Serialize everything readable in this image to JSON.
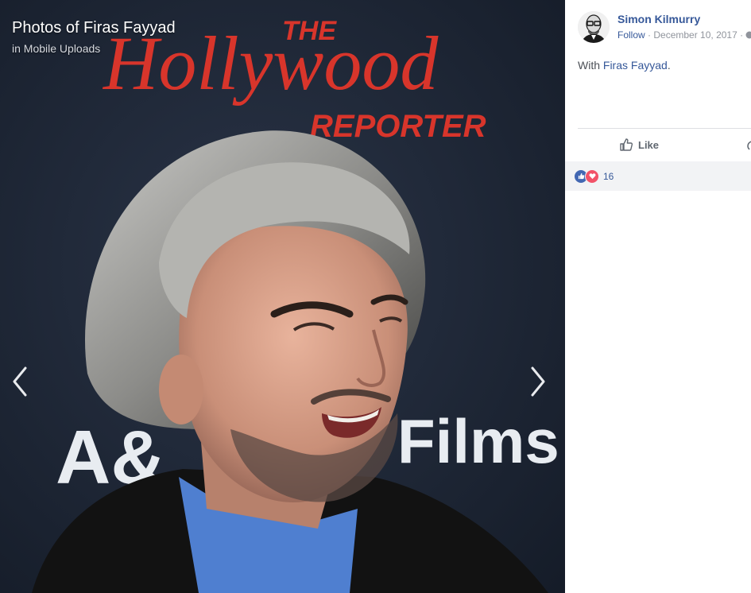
{
  "viewer": {
    "title": "Photos of Firas Fayyad",
    "album": "in Mobile Uploads",
    "sign_line1": "THE",
    "sign_line2": "Hollywood",
    "sign_line3": "REPORTER",
    "sign_line4": "A&",
    "sign_line5": "Films"
  },
  "post": {
    "author": "Simon Kilmurry",
    "follow": "Follow",
    "separator": " · ",
    "date": "December 10, 2017",
    "with_prefix": "With ",
    "tagged": "Firas Fayyad",
    "with_suffix": "."
  },
  "actions": {
    "like": "Like"
  },
  "reactions": {
    "count": "16"
  },
  "colors": {
    "link": "#365899",
    "like_blue": "#4267b2",
    "love_red": "#f25268",
    "sign_red": "#d8352b"
  },
  "icons": [
    "chevron-left-icon",
    "chevron-right-icon",
    "thumbs-up-icon",
    "like-reaction-icon",
    "love-reaction-icon",
    "globe-icon",
    "comment-icon"
  ]
}
